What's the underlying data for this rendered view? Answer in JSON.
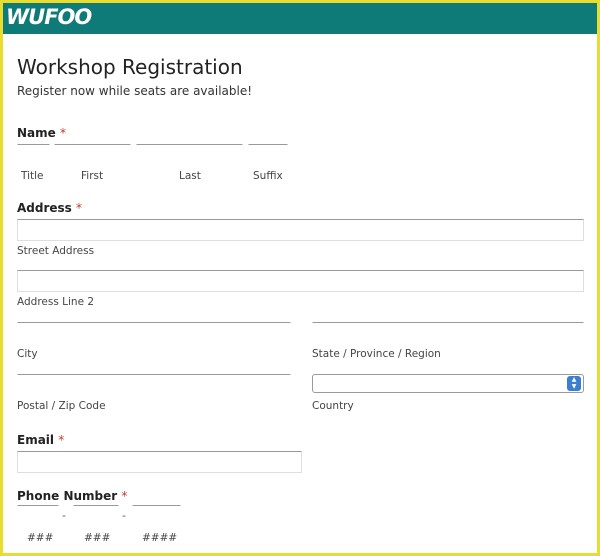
{
  "brand": {
    "logo": "WUFOO",
    "header_color": "#0e7b78",
    "frame_color": "#e8dc2c"
  },
  "form": {
    "title": "Workshop Registration",
    "subtitle": "Register now while seats are available!"
  },
  "name": {
    "label": "Name",
    "required": "*",
    "title_label": "Title",
    "first_label": "First",
    "last_label": "Last",
    "suffix_label": "Suffix"
  },
  "address": {
    "label": "Address",
    "required": "*",
    "street_label": "Street Address",
    "line2_label": "Address Line 2",
    "city_label": "City",
    "state_label": "State / Province / Region",
    "zip_label": "Postal / Zip Code",
    "country_label": "Country"
  },
  "email": {
    "label": "Email",
    "required": "*"
  },
  "phone": {
    "label": "Phone Number",
    "required": "*",
    "separator": "-",
    "area_label": "###",
    "prefix_label": "###",
    "line_label": "####"
  }
}
